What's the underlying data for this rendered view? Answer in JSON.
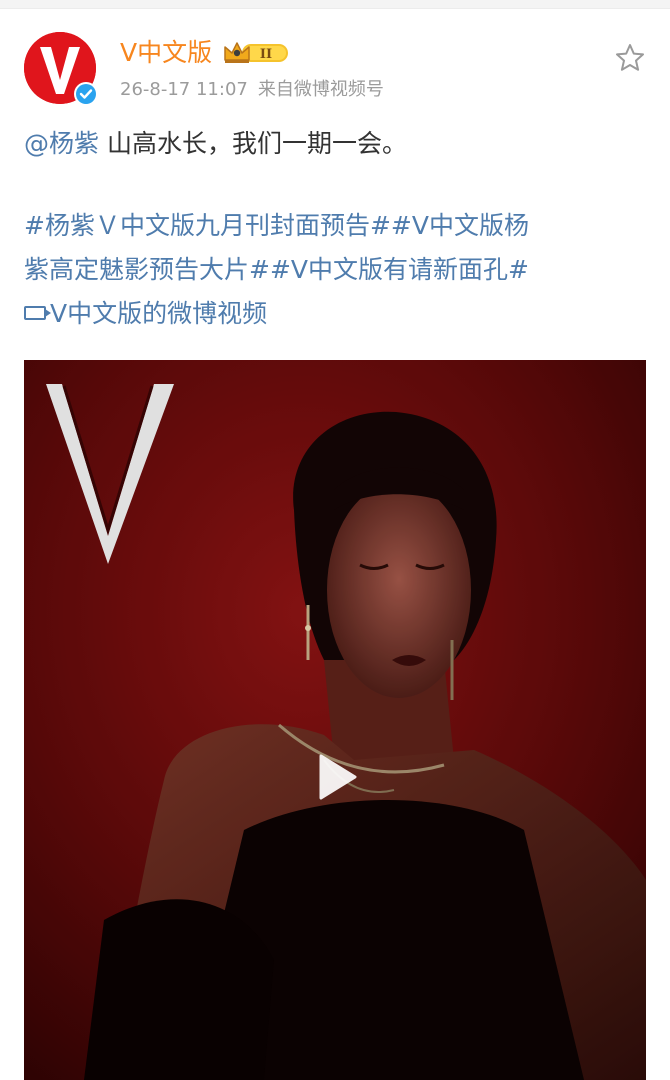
{
  "post": {
    "author": {
      "name": "V中文版",
      "vip_level": "II",
      "verified": true
    },
    "timestamp": "26-8-17 11:07",
    "source": "来自微博视频号",
    "text": {
      "mention": "@杨紫",
      "content": " 山高水长，我们一期一会。",
      "hashtag_line_1": "#杨紫Ｖ中文版九月刊封面预告##V中文版杨",
      "hashtag_line_2": "紫高定魅影预告大片##V中文版有请新面孔#",
      "video_link": "V中文版的微博视频"
    }
  },
  "icons": {
    "favorite": "star-outline-icon",
    "play": "play-icon",
    "video_link": "video-camera-icon",
    "verified": "verified-badge-icon",
    "vip": "crown-badge-icon"
  },
  "colors": {
    "username": "#f7861e",
    "link": "#4f7cad",
    "meta": "#9b9b9b",
    "avatar_bg": "#e0151c",
    "verified": "#2aa3ef"
  }
}
